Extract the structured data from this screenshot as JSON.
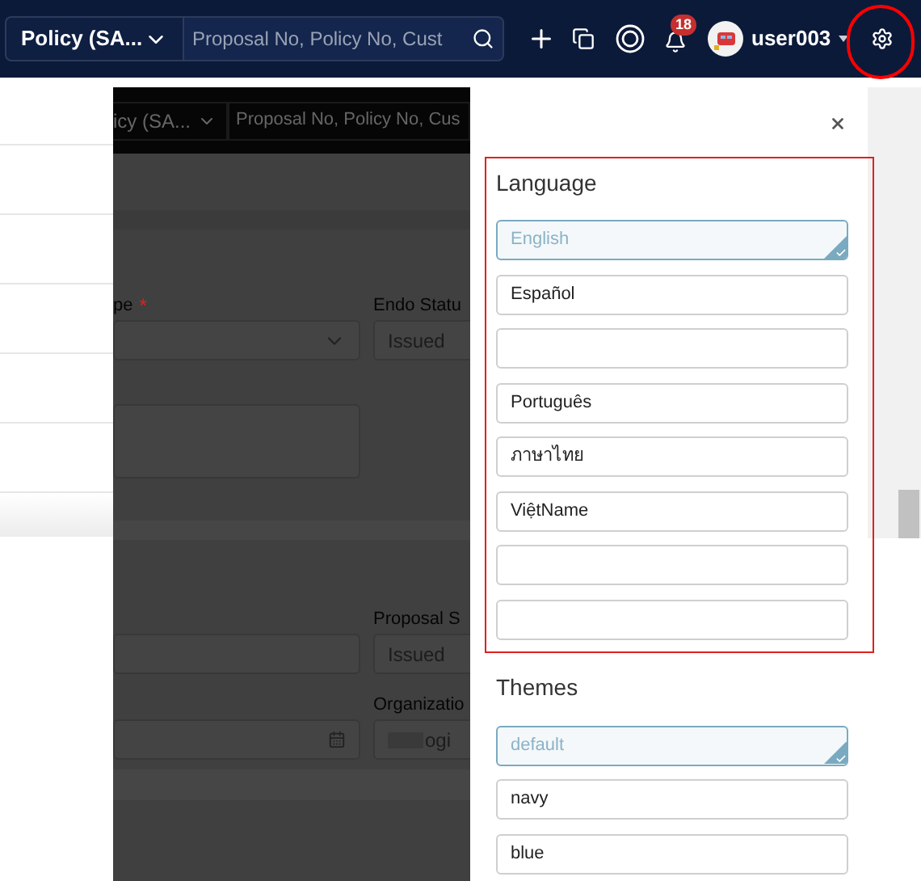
{
  "navbar": {
    "product_select": "Policy (SA...",
    "search": {
      "placeholder": "Proposal No, Policy No, Cust"
    },
    "notifications": {
      "badge": "18"
    },
    "user": "user003"
  },
  "background_page": {
    "product_select": "icy (SA...",
    "search": {
      "placeholder": "Proposal No, Policy No, Cus"
    },
    "fields": [
      {
        "label": "pe",
        "required_mark": "*",
        "kind": "select"
      },
      {
        "label": "Endo Statu",
        "kind": "text",
        "value": "Issued"
      },
      {
        "kind": "textarea"
      },
      {
        "label": "Proposal S",
        "kind": "text",
        "value": "Issued"
      },
      {
        "label": "Organizatio",
        "kind": "text",
        "value": "ogi"
      }
    ]
  },
  "settings_panel": {
    "language": {
      "title": "Language",
      "options": [
        {
          "label": "English",
          "selected": true,
          "kind": "text"
        },
        {
          "label": "Español",
          "selected": false,
          "kind": "text"
        },
        {
          "selected": false,
          "kind": "blank"
        },
        {
          "label": "Português",
          "selected": false,
          "kind": "text"
        },
        {
          "label": "ภาษาไทย",
          "selected": false,
          "kind": "text"
        },
        {
          "label": "ViệtName",
          "selected": false,
          "kind": "text"
        },
        {
          "selected": false,
          "kind": "blank"
        },
        {
          "selected": false,
          "kind": "blank"
        }
      ]
    },
    "themes": {
      "title": "Themes",
      "options": [
        {
          "label": "default",
          "selected": true,
          "kind": "text"
        },
        {
          "label": "navy",
          "selected": false,
          "kind": "text"
        },
        {
          "label": "blue",
          "selected": false,
          "kind": "text"
        }
      ]
    }
  }
}
